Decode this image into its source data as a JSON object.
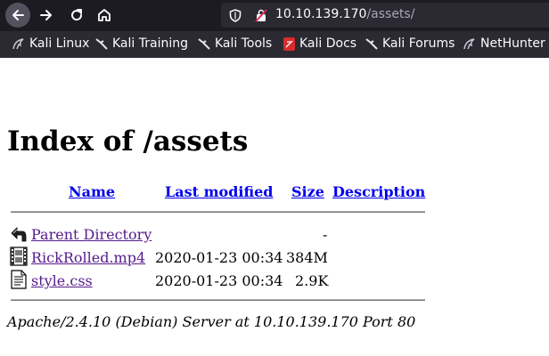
{
  "browser": {
    "url_host": "10.10.139.170",
    "url_path": "/assets/"
  },
  "bookmarks": [
    {
      "label": "Kali Linux",
      "icon": "kali-dragon-icon"
    },
    {
      "label": "Kali Training",
      "icon": "kali-dragon-icon"
    },
    {
      "label": "Kali Tools",
      "icon": "kali-dragon-icon"
    },
    {
      "label": "Kali Docs",
      "icon": "kali-docs-icon"
    },
    {
      "label": "Kali Forums",
      "icon": "kali-dragon-icon"
    },
    {
      "label": "NetHunter",
      "icon": "nethunter-icon"
    }
  ],
  "page": {
    "title": "Index of /assets",
    "columns": {
      "name": "Name",
      "modified": "Last modified",
      "size": "Size",
      "description": "Description"
    },
    "rows": [
      {
        "name": "Parent Directory",
        "modified": "",
        "size": "-",
        "icon": "back-arrow-icon"
      },
      {
        "name": "RickRolled.mp4",
        "modified": "2020-01-23 00:34",
        "size": "384M",
        "icon": "film-icon"
      },
      {
        "name": "style.css",
        "modified": "2020-01-23 00:34",
        "size": "2.9K",
        "icon": "text-file-icon"
      }
    ],
    "footer": "Apache/2.4.10 (Debian) Server at 10.10.139.170 Port 80"
  },
  "colors": {
    "link_unvisited": "#0000ee",
    "link_visited": "#551a8b",
    "toolbar_bg": "#1c1b22",
    "bookmarks_bg": "#2b2a33"
  }
}
